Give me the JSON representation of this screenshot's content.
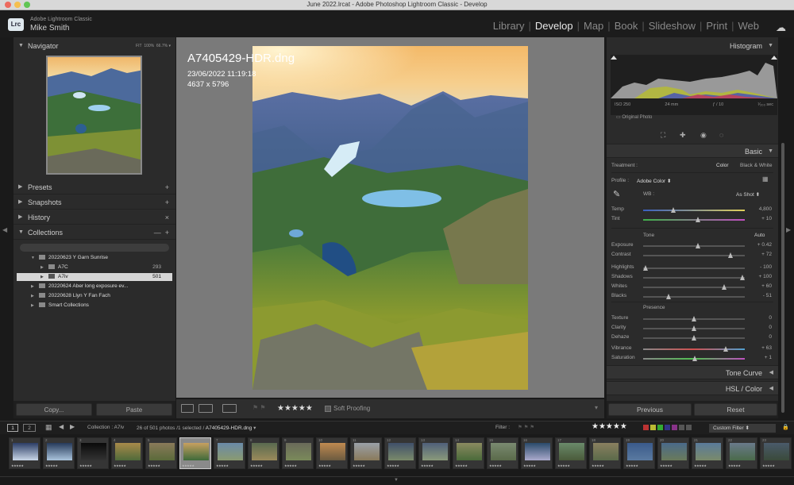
{
  "window": {
    "title": "June 2022.lrcat - Adobe Photoshop Lightroom Classic - Develop"
  },
  "identity": {
    "logo": "Lrc",
    "app": "Adobe Lightroom Classic",
    "user": "Mike Smith"
  },
  "modules": [
    "Library",
    "Develop",
    "Map",
    "Book",
    "Slideshow",
    "Print",
    "Web"
  ],
  "active_module": "Develop",
  "left_panel": {
    "navigator": {
      "title": "Navigator",
      "fit": "FIT",
      "z1": "100%",
      "z2": "66.7%"
    },
    "presets": "Presets",
    "snapshots": "Snapshots",
    "history": "History",
    "collections": {
      "title": "Collections",
      "items": [
        {
          "label": "20220623 Y Garn Sunrise",
          "count": ""
        },
        {
          "label": "A7C",
          "count": "293"
        },
        {
          "label": "A7iv",
          "count": "501"
        },
        {
          "label": "20220624 Aber long exposure ev...",
          "count": ""
        },
        {
          "label": "20220628 Llyn Y Fan Fach",
          "count": ""
        },
        {
          "label": "Smart Collections",
          "count": ""
        }
      ]
    },
    "copy_label": "Copy...",
    "paste_label": "Paste"
  },
  "photo_info": {
    "filename": "A7405429-HDR.dng",
    "datetime": "23/06/2022 11:19:18",
    "dimensions": "4637 x 5796"
  },
  "toolbar": {
    "soft_proofing": "Soft Proofing",
    "rating": "★★★★★"
  },
  "right_panel": {
    "histogram": {
      "title": "Histogram",
      "iso": "ISO 250",
      "focal": "24 mm",
      "aperture": "ƒ / 10",
      "shutter": "¹⁄₂₀₀ sec",
      "original": "Original Photo"
    },
    "basic": {
      "title": "Basic",
      "treatment_label": "Treatment :",
      "treatment_color": "Color",
      "treatment_bw": "Black & White",
      "profile_label": "Profile :",
      "profile_value": "Adobe Color",
      "wb_label": "WB :",
      "wb_value": "As Shot",
      "tone_label": "Tone",
      "auto_label": "Auto",
      "presence_label": "Presence",
      "sliders": [
        {
          "label": "Temp",
          "value": "4,800",
          "pos": 0.3,
          "grad": "temp"
        },
        {
          "label": "Tint",
          "value": "+ 10",
          "pos": 0.54,
          "grad": "tint"
        },
        {
          "label": "Exposure",
          "value": "+ 0.42",
          "pos": 0.54,
          "grad": ""
        },
        {
          "label": "Contrast",
          "value": "+ 72",
          "pos": 0.86,
          "grad": ""
        },
        {
          "label": "Highlights",
          "value": "- 100",
          "pos": 0.02,
          "grad": ""
        },
        {
          "label": "Shadows",
          "value": "+ 100",
          "pos": 0.98,
          "grad": ""
        },
        {
          "label": "Whites",
          "value": "+ 60",
          "pos": 0.8,
          "grad": ""
        },
        {
          "label": "Blacks",
          "value": "- 51",
          "pos": 0.25,
          "grad": ""
        },
        {
          "label": "Texture",
          "value": "0",
          "pos": 0.5,
          "grad": ""
        },
        {
          "label": "Clarity",
          "value": "0",
          "pos": 0.5,
          "grad": ""
        },
        {
          "label": "Dehaze",
          "value": "0",
          "pos": 0.5,
          "grad": ""
        },
        {
          "label": "Vibrance",
          "value": "+ 63",
          "pos": 0.81,
          "grad": "vib"
        },
        {
          "label": "Saturation",
          "value": "+ 1",
          "pos": 0.51,
          "grad": "sat"
        }
      ]
    },
    "tone_curve": "Tone Curve",
    "hsl": "HSL / Color",
    "previous_label": "Previous",
    "reset_label": "Reset"
  },
  "filmstrip": {
    "page1": "1",
    "page2": "2",
    "source": "Collection : A7iv",
    "count": "26 of 501 photos /1 selected /",
    "file": "A7405429-HDR.dng",
    "filter_label": "Filter :",
    "filter_stars": "★★★★★",
    "custom_filter": "Custom Filter",
    "thumb_numbers": [
      "1",
      "2",
      "3",
      "4",
      "5",
      "6",
      "7",
      "8",
      "9",
      "10",
      "11",
      "12",
      "13",
      "14",
      "15",
      "16",
      "17",
      "18",
      "19",
      "20",
      "21",
      "22",
      "23"
    ]
  }
}
